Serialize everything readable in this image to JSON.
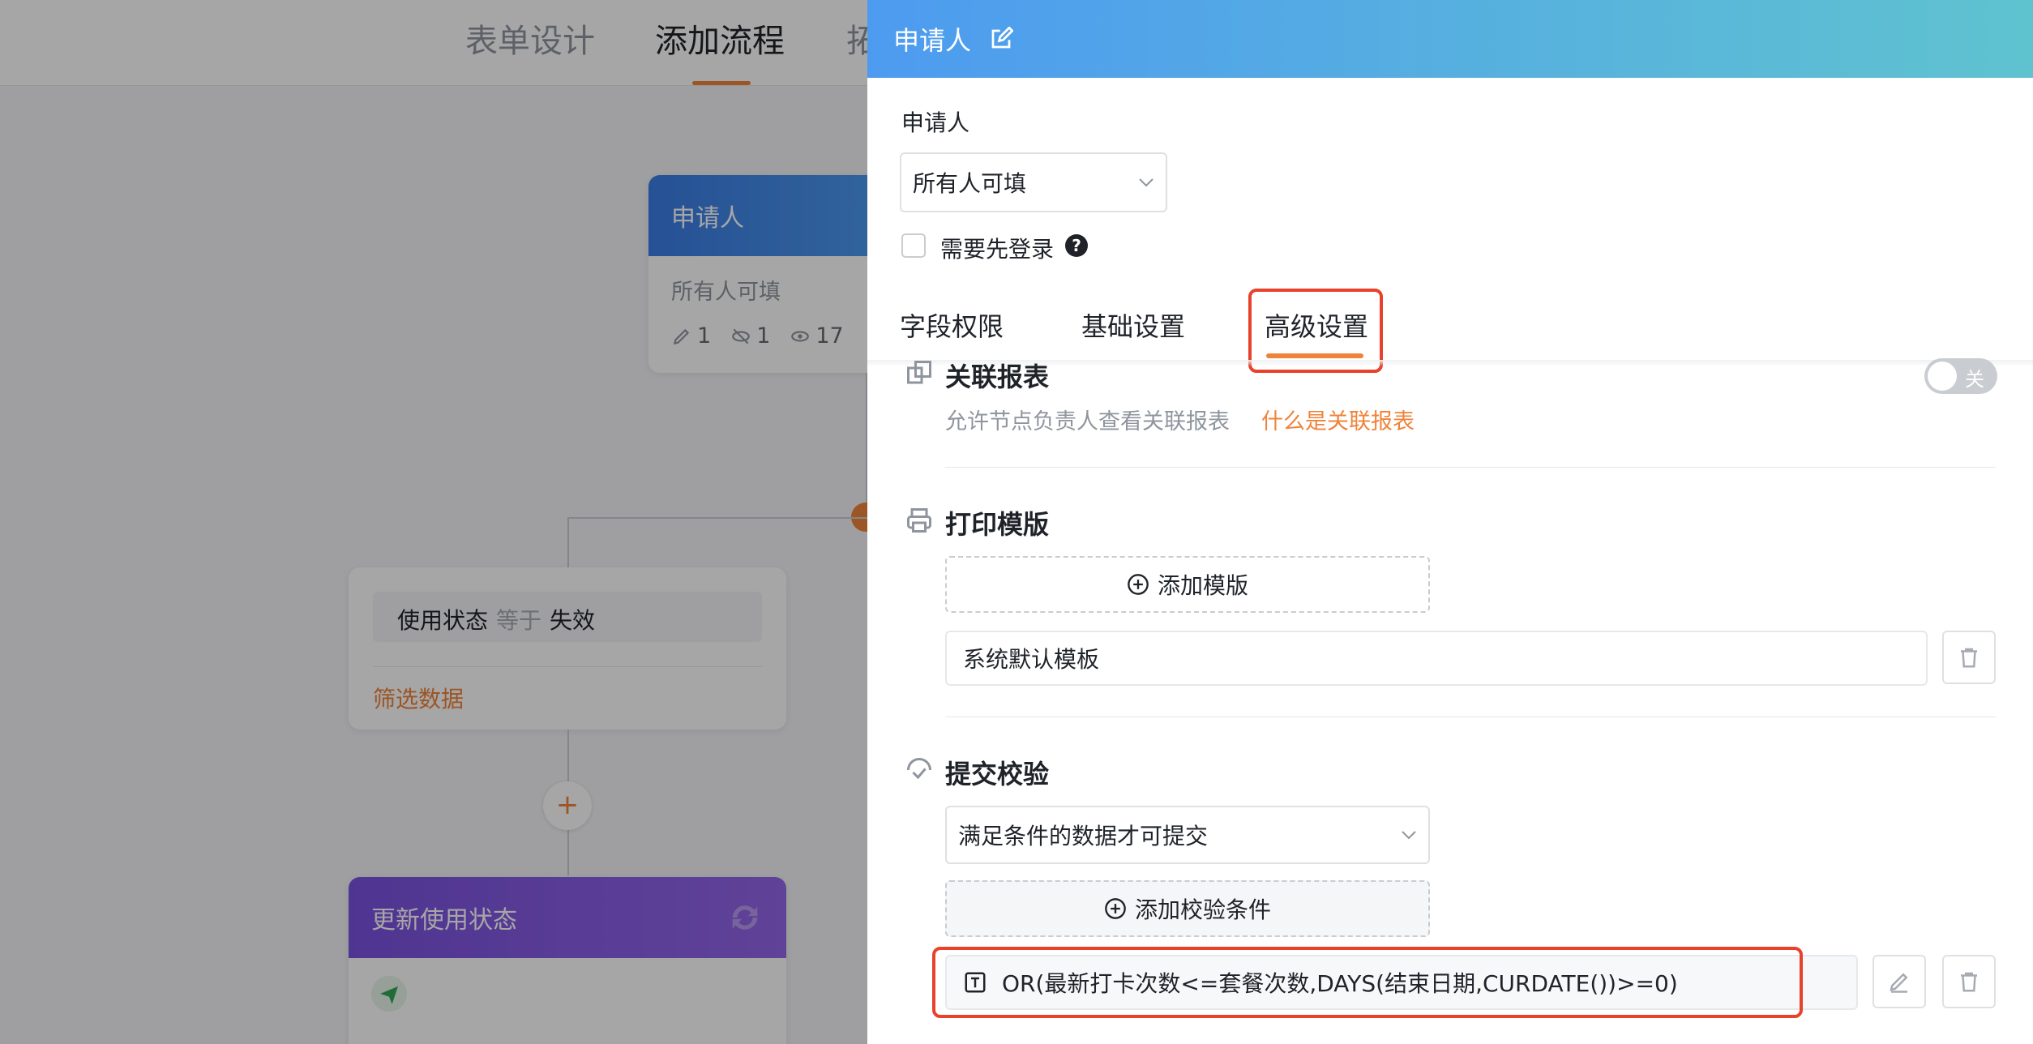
{
  "topbar": {
    "tabs": [
      {
        "label": "表单设计"
      },
      {
        "label": "添加流程"
      },
      {
        "label": "拓"
      }
    ]
  },
  "canvas": {
    "applicant_node": {
      "title": "申请人",
      "subtitle": "所有人可填",
      "stats": {
        "edit": "1",
        "hidden": "1",
        "view": "17"
      }
    },
    "condition_node": {
      "field": "使用状态",
      "operator": "等于",
      "value": "失效",
      "link": "筛选数据"
    },
    "add_button": "+",
    "update_node": {
      "title": "更新使用状态"
    }
  },
  "drawer": {
    "title": "申请人",
    "applicant_label": "申请人",
    "permission_select": "所有人可填",
    "login_checkbox_label": "需要先登录",
    "help_glyph": "?",
    "tabs": [
      {
        "label": "字段权限"
      },
      {
        "label": "基础设置"
      },
      {
        "label": "高级设置"
      }
    ],
    "related_report": {
      "title": "关联报表",
      "desc": "允许节点负责人查看关联报表",
      "link": "什么是关联报表",
      "toggle_label": "关"
    },
    "print_template": {
      "title": "打印模版",
      "add_button": "添加模版",
      "template_name": "系统默认模板"
    },
    "submit_validation": {
      "title": "提交校验",
      "mode_select": "满足条件的数据才可提交",
      "add_button": "添加校验条件",
      "formula": "OR(最新打卡次数<=套餐次数,DAYS(结束日期,CURDATE())>=0)"
    }
  },
  "colors": {
    "accent": "#f0833a",
    "highlight": "#e8412c",
    "header_gradient_start": "#4d9bf0",
    "header_gradient_end": "#5fc3cf"
  }
}
